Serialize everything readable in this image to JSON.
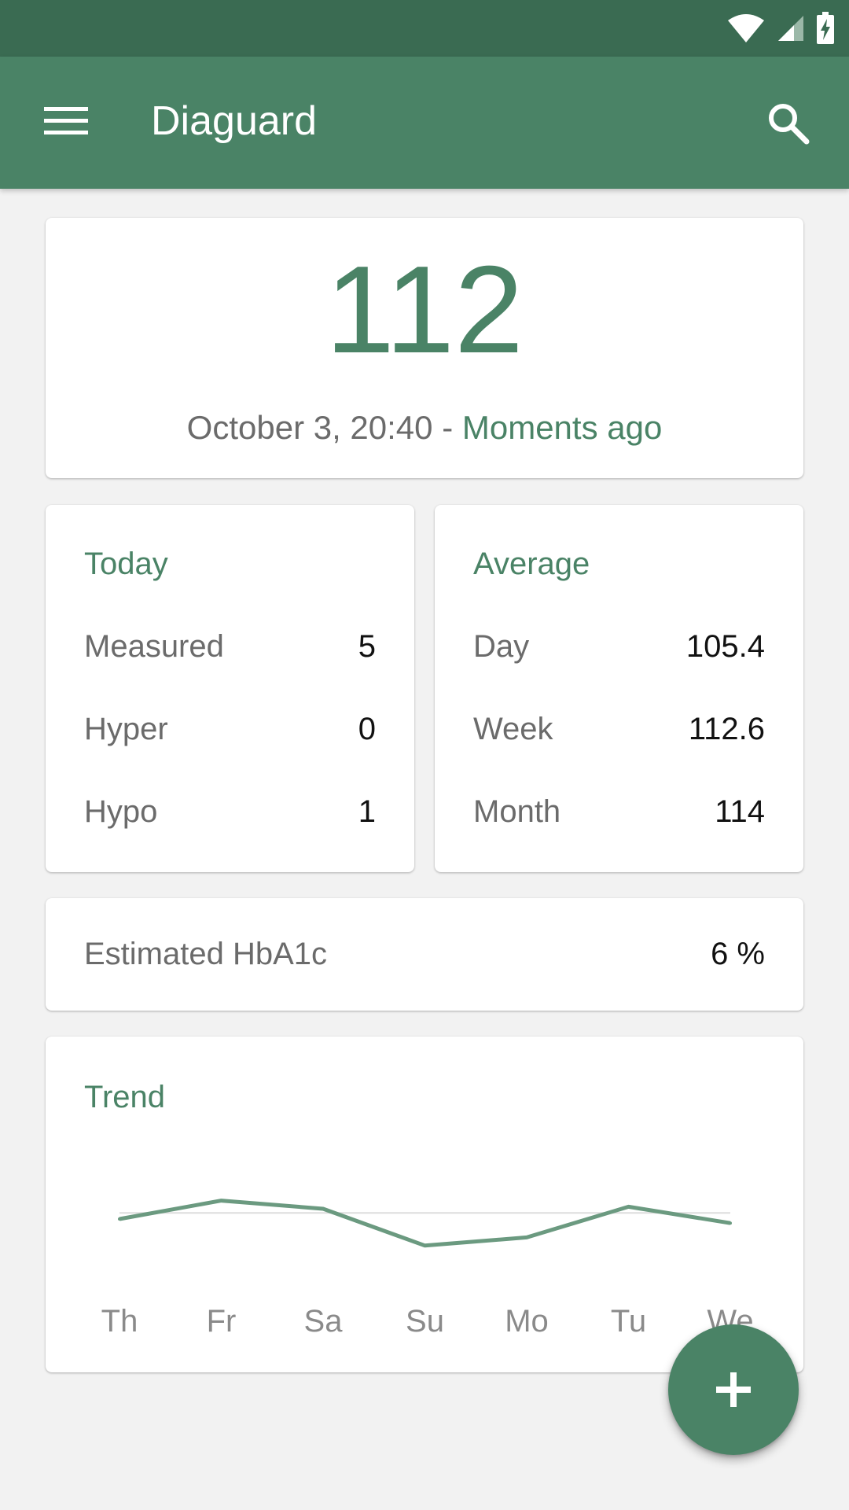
{
  "app": {
    "title": "Diaguard",
    "colors": {
      "primary": "#4a8366",
      "primary_dark": "#3a6b52",
      "background": "#f2f2f2"
    }
  },
  "status_bar": {
    "icons": [
      "wifi-icon",
      "cellular-signal-icon",
      "battery-charging-icon"
    ]
  },
  "toolbar": {
    "menu_icon": "menu-icon",
    "search_icon": "search-icon"
  },
  "latest": {
    "value": "112",
    "datetime": "October 3, 20:40 -",
    "relative": "Moments ago"
  },
  "today": {
    "title": "Today",
    "rows": [
      {
        "label": "Measured",
        "value": "5"
      },
      {
        "label": "Hyper",
        "value": "0"
      },
      {
        "label": "Hypo",
        "value": "1"
      }
    ]
  },
  "average": {
    "title": "Average",
    "rows": [
      {
        "label": "Day",
        "value": "105.4"
      },
      {
        "label": "Week",
        "value": "112.6"
      },
      {
        "label": "Month",
        "value": "114"
      }
    ]
  },
  "hba1c": {
    "label": "Estimated HbA1c",
    "value": "6 %"
  },
  "trend": {
    "title": "Trend"
  },
  "chart_data": {
    "type": "line",
    "title": "Trend",
    "categories": [
      "Th",
      "Fr",
      "Sa",
      "Su",
      "Mo",
      "Tu",
      "We"
    ],
    "series": [
      {
        "values": [
          110,
          119,
          115,
          97,
          101,
          116,
          108
        ]
      }
    ],
    "reference_line": 113,
    "ylim": [
      60,
      160
    ],
    "grid": false,
    "color": "#6b9a80"
  },
  "fab": {
    "icon": "plus-icon"
  }
}
